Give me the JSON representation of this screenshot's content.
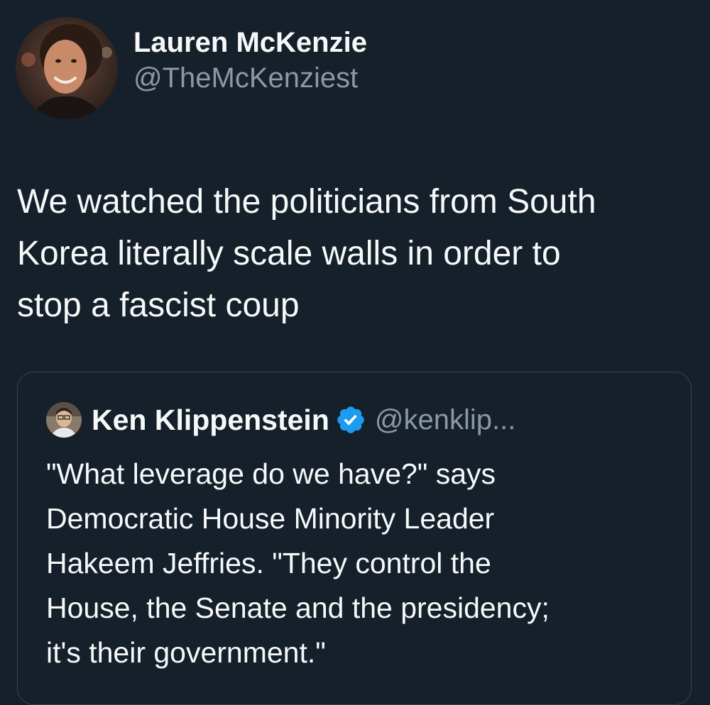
{
  "tweet": {
    "author": {
      "display_name": "Lauren McKenzie",
      "handle": "@TheMcKenziest"
    },
    "text": "We watched the politicians from South\nKorea literally scale walls in order to\nstop a fascist coup"
  },
  "quoted_tweet": {
    "author": {
      "display_name": "Ken Klippenstein",
      "handle": "@kenklip..."
    },
    "text": "\"What leverage do we have?\" says\nDemocratic House Minority Leader\nHakeem Jeffries. \"They control the\nHouse, the Senate and the presidency;\nit's their government.\""
  },
  "icons": {
    "verified": "verified-badge-icon"
  },
  "colors": {
    "background": "#15202b",
    "text_primary": "#f7f9f9",
    "text_secondary": "#8b98a5",
    "border": "#38444d",
    "verified_blue": "#1d9bf0"
  }
}
